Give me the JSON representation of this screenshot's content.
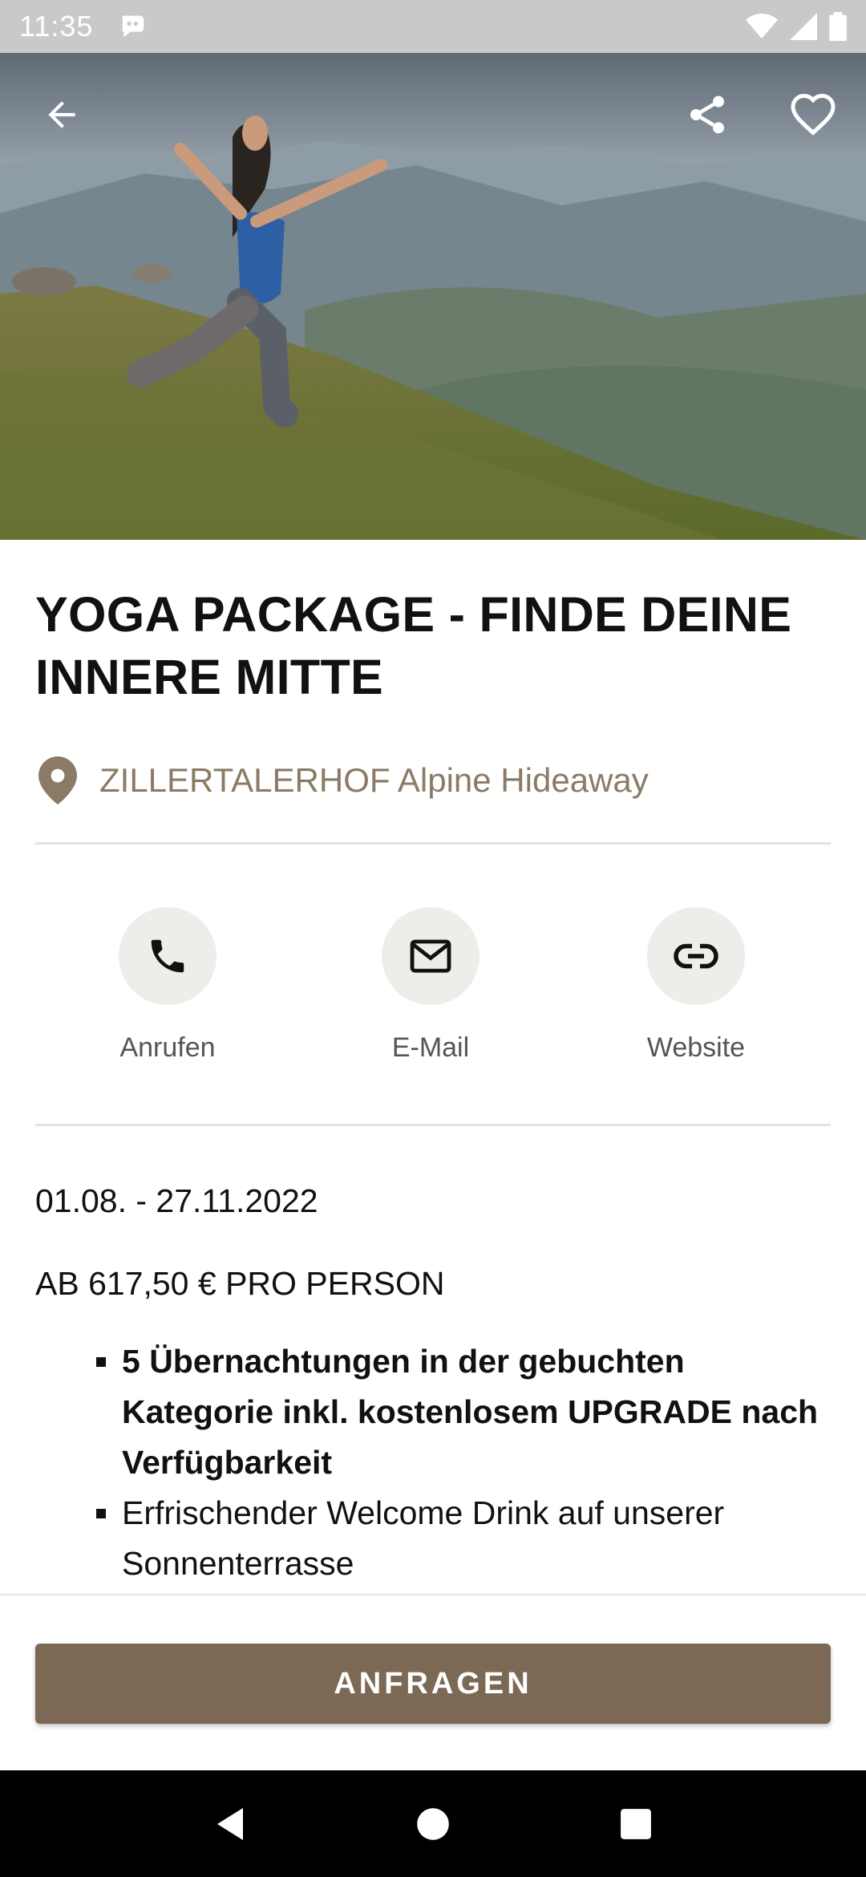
{
  "status_bar": {
    "time": "11:35",
    "icons": [
      "notification-icon",
      "wifi-icon",
      "signal-icon",
      "battery-icon"
    ]
  },
  "hero": {
    "image": "woman doing yoga warrior pose on a grassy alpine slope with mountains in background",
    "buttons": [
      "back-arrow-icon",
      "share-icon",
      "heart-icon"
    ]
  },
  "detail": {
    "title": "YOGA PACKAGE - FINDE DEINE INNERE MITTE",
    "location": "ZILLERTALERHOF Alpine Hideaway"
  },
  "actions": {
    "call_label": "Anrufen",
    "mail_label": "E-Mail",
    "web_label": "Website"
  },
  "info": {
    "dates": "01.08. - 27.11.2022",
    "price": "AB 617,50 € PRO PERSON",
    "bullets": [
      "5 Übernachtungen in der gebuchten Kategorie inkl. kostenlosem UPGRADE nach Verfügbarkeit",
      "Erfrischender Welcome Drink auf unserer Sonnenterrasse"
    ]
  },
  "cta": {
    "label": "ANFRAGEN"
  },
  "colors": {
    "accent": "#7b6955",
    "location_text": "#8b7a66",
    "icon_circle": "#efedea"
  }
}
